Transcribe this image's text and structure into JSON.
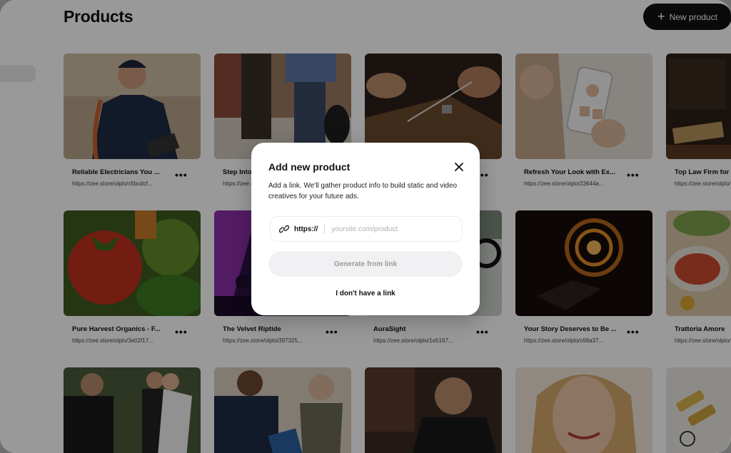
{
  "header": {
    "title": "Products",
    "new_button_label": "New product"
  },
  "products": [
    {
      "title": "Reliable Electricians You ...",
      "url": "https://zee.store/olplo/c5bcdcf...",
      "image": "electrician"
    },
    {
      "title": "Step Into",
      "url": "https://zee.store/olplo/",
      "image": "shoes"
    },
    {
      "title": "",
      "url": "",
      "image": "leather-craft"
    },
    {
      "title": "Refresh Your Look with Ex...",
      "url": "https://zee.store/olplo/23644a...",
      "image": "beauty-app"
    },
    {
      "title": "Top Law Firm for",
      "url": "https://zee.store/olplo/",
      "image": "law-library"
    },
    {
      "title": "Pure Harvest Organics - F...",
      "url": "https://zee.store/olplo/3e02f17...",
      "image": "vegetables"
    },
    {
      "title": "The Velvet Riptide",
      "url": "https://zee.store/olplo/397325...",
      "image": "concert"
    },
    {
      "title": "AuraSight",
      "url": "https://zee.store/olplo/1e5167...",
      "image": "eyewear"
    },
    {
      "title": "Your Story Deserves to Be ...",
      "url": "https://zee.store/olplo/c68a37...",
      "image": "vortex"
    },
    {
      "title": "Trattoria Amore",
      "url": "https://zee.store/olplo/",
      "image": "salad"
    },
    {
      "title": "",
      "url": "",
      "image": "wedding"
    },
    {
      "title": "",
      "url": "",
      "image": "bank"
    },
    {
      "title": "",
      "url": "",
      "image": "tattoo"
    },
    {
      "title": "",
      "url": "",
      "image": "smiling-woman"
    },
    {
      "title": "",
      "url": "",
      "image": "energy"
    }
  ],
  "more_glyph": "•••",
  "modal": {
    "title": "Add new product",
    "description": "Add a link. We'll gather product info to build static and video creatives for your future ads.",
    "url_prefix": "https://",
    "url_placeholder": "yoursite.com/product",
    "url_value": "",
    "generate_label": "Generate from link",
    "no_link_label": "I don't have a link"
  },
  "colors": {
    "accent_dark": "#111111",
    "overlay": "rgba(0,0,0,0.40)",
    "disabled_button": "#f1f1f3"
  },
  "icons": [
    "plus-icon",
    "more-icon",
    "close-icon",
    "link-icon"
  ]
}
